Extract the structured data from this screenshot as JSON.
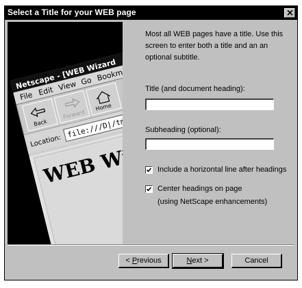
{
  "window": {
    "title": "Select a Title for your WEB page"
  },
  "illustration": {
    "browser_title": "Netscape - [WEB Wizard",
    "menu": [
      "File",
      "Edit",
      "View",
      "Go",
      "Bookm"
    ],
    "toolbar": [
      "Back",
      "Forward",
      "Home"
    ],
    "location_label": "Location:",
    "location_value": "file:///D|/tmp",
    "page_heading": "WEB Wi"
  },
  "intro": {
    "text": "Most all WEB pages have a title. Use this screen to enter both a title and an an optional subtitle."
  },
  "title_field": {
    "label": "Title (and document heading):",
    "value": ""
  },
  "subheading_field": {
    "label": "Subheading (optional):",
    "value": ""
  },
  "options": {
    "horizontal_line": {
      "label": "Include a horizontal line after headings",
      "checked": true
    },
    "center_headings": {
      "label": "Center headings on page",
      "sublabel": "(using NetScape enhancements)",
      "checked": true
    }
  },
  "buttons": {
    "previous_prefix": "< ",
    "previous_key": "P",
    "previous_rest": "revious",
    "next_key": "N",
    "next_rest": "ext >",
    "cancel": "Cancel"
  }
}
